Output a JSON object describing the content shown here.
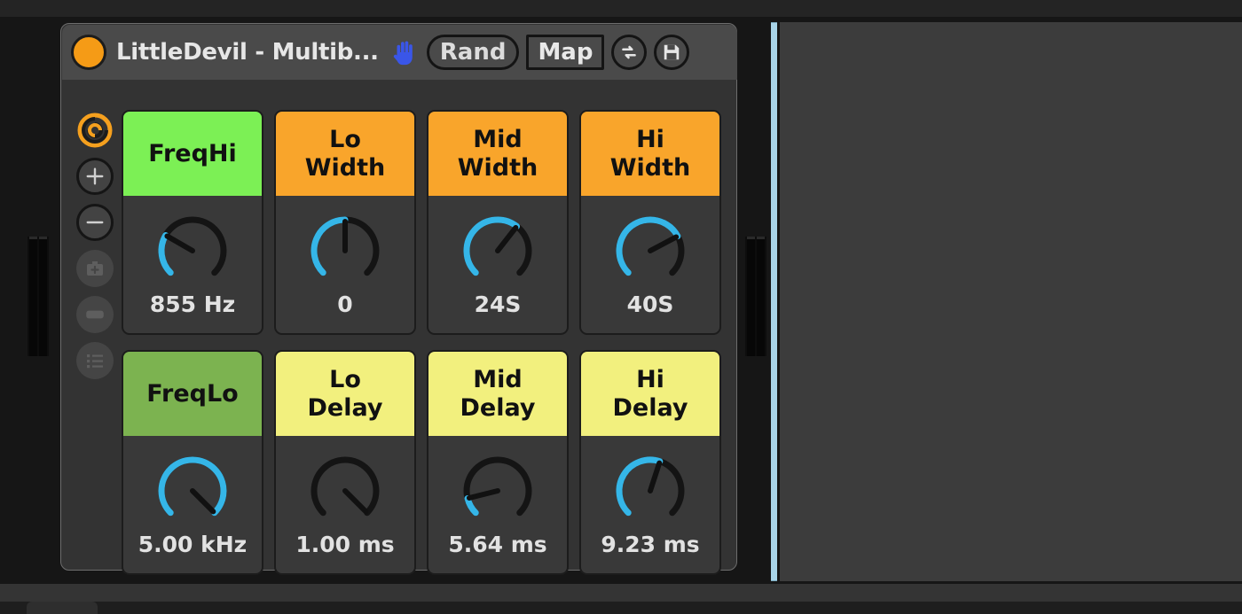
{
  "window": {
    "top_strip_color": "#242424",
    "background_color": "#161616"
  },
  "device": {
    "title": "LittleDevil - Multib...",
    "power_dot_color": "#f59b16",
    "titlebar_color": "#4a4a4a",
    "toolbar": {
      "hand_icon": "hand-icon",
      "hand_icon_color": "#3a56e8",
      "rand_label": "Rand",
      "map_label": "Map",
      "swap_icon": "swap-arrows-icon",
      "save_icon": "floppy-disk-save-icon"
    },
    "rail": [
      {
        "name": "macro-spiral-toggle",
        "icon": "spiral-icon",
        "state": "active",
        "color": "#f5a01e"
      },
      {
        "name": "add-macro-button",
        "icon": "plus-icon",
        "state": "enabled",
        "color": "#cfcfcf"
      },
      {
        "name": "remove-macro-button",
        "icon": "minus-icon",
        "state": "enabled",
        "color": "#cfcfcf"
      },
      {
        "name": "snapshot-button",
        "icon": "camera-icon",
        "state": "dimmed",
        "color": "#5e5e5e"
      },
      {
        "name": "bank-button",
        "icon": "minus-box-icon",
        "state": "dimmed",
        "color": "#5e5e5e"
      },
      {
        "name": "list-view-button",
        "icon": "list-icon",
        "state": "dimmed",
        "color": "#5e5e5e"
      }
    ]
  },
  "colors": {
    "green_bright": "#7cf055",
    "green_muted": "#7cb350",
    "orange": "#f9a52b",
    "yellow": "#f2f07e",
    "knob_track": "#141414",
    "knob_fill": "#35b6e8",
    "knob_pointer": "#111111",
    "divider_blue": "#a8d4e8"
  },
  "macros": {
    "rows": [
      [
        {
          "label": "FreqHi",
          "value": "855 Hz",
          "header_color": "#7cf055",
          "angle": -60,
          "fill_from_min": true
        },
        {
          "label": "Lo\nWidth",
          "value": "0",
          "header_color": "#f9a52b",
          "angle": 0,
          "fill_from_min": true
        },
        {
          "label": "Mid\nWidth",
          "value": "24S",
          "header_color": "#f9a52b",
          "angle": 38,
          "fill_from_min": true
        },
        {
          "label": "Hi\nWidth",
          "value": "40S",
          "header_color": "#f9a52b",
          "angle": 62,
          "fill_from_min": true
        }
      ],
      [
        {
          "label": "FreqLo",
          "value": "5.00 kHz",
          "header_color": "#7cb350",
          "angle": 160,
          "fill_from_min": true
        },
        {
          "label": "Lo\nDelay",
          "value": "1.00 ms",
          "header_color": "#f2f07e",
          "angle": 152,
          "fill_from_min": false
        },
        {
          "label": "Mid\nDelay",
          "value": "5.64 ms",
          "header_color": "#f2f07e",
          "angle": -104,
          "fill_from_min": true
        },
        {
          "label": "Hi\nDelay",
          "value": "9.23 ms",
          "header_color": "#f2f07e",
          "angle": 18,
          "fill_from_min": true
        }
      ]
    ]
  },
  "meters": {
    "left_label": "track-level-meter-left",
    "right_label": "track-level-meter-right"
  }
}
